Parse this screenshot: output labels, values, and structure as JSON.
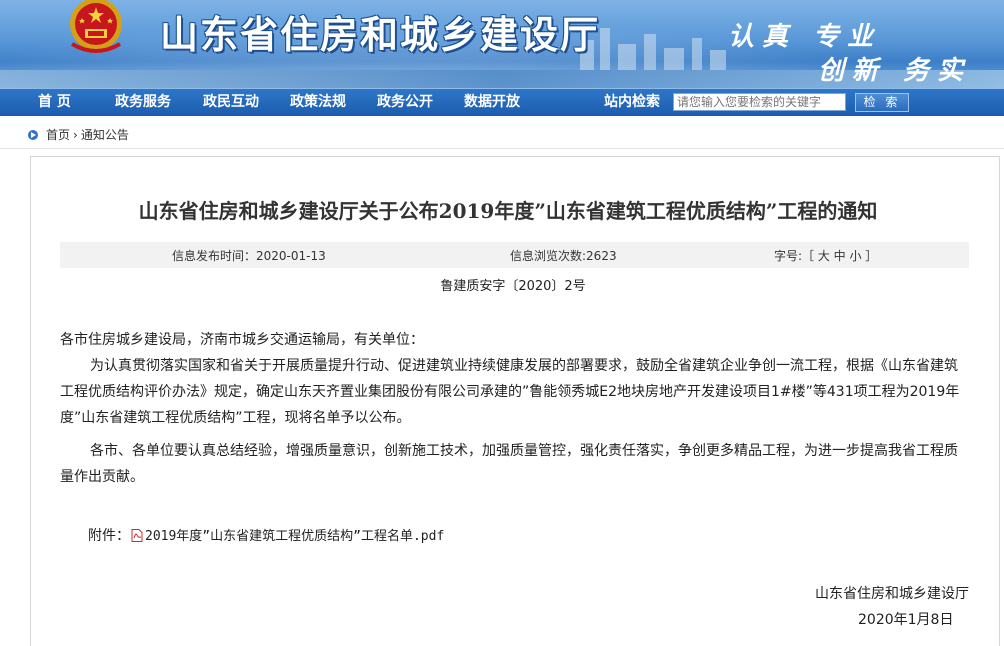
{
  "header": {
    "site_title": "山东省住房和城乡建设厅",
    "slogan_line1": "认真 专业",
    "slogan_line2": "创新 务实",
    "colors": {
      "banner_blue": "#4a8ad0",
      "nav_blue": "#2266b8"
    }
  },
  "nav": {
    "items": [
      "首 页",
      "政务服务",
      "政民互动",
      "政策法规",
      "政务公开",
      "数据开放"
    ],
    "search_label": "站内检索",
    "search_placeholder": "请您输入您要检索的关键字",
    "search_button": "检 索"
  },
  "breadcrumb": {
    "home": "首页",
    "separator": "›",
    "current": "通知公告"
  },
  "article": {
    "title": "山东省住房和城乡建设厅关于公布2019年度”山东省建筑工程优质结构”工程的通知",
    "publish_time": "信息发布时间：2020-01-13",
    "views": "信息浏览次数:2623",
    "font_size_label": "字号:［ 大 中 小 ］",
    "doc_number": "鲁建质安字〔2020〕2号",
    "salutation": "各市住房城乡建设局，济南市城乡交通运输局，有关单位：",
    "para1_line1": "为认真贯彻落实国家和省关于开展质量提升行动、促进建筑业持续健康发展的部署要求，鼓励全省建筑企业争创一流工程，根据《山东省建筑",
    "para1_line2": "工程优质结构评价办法》规定，确定山东天齐置业集团股份有限公司承建的”鲁能领秀城E2地块房地产开发建设项目1#楼”等431项工程为2019年",
    "para1_line3": "度”山东省建筑工程优质结构”工程，现将名单予以公布。",
    "para2_line1": "各市、各单位要认真总结经验，增强质量意识，创新施工技术，加强质量管控，强化责任落实，争创更多精品工程，为进一步提高我省工程质",
    "para2_line2": "量作出贡献。",
    "attachment_label": "附件：",
    "attachment_name": "2019年度”山东省建筑工程优质结构”工程名单.pdf",
    "signature": "山东省住房和城乡建设厅",
    "date": "2020年1月8日"
  }
}
